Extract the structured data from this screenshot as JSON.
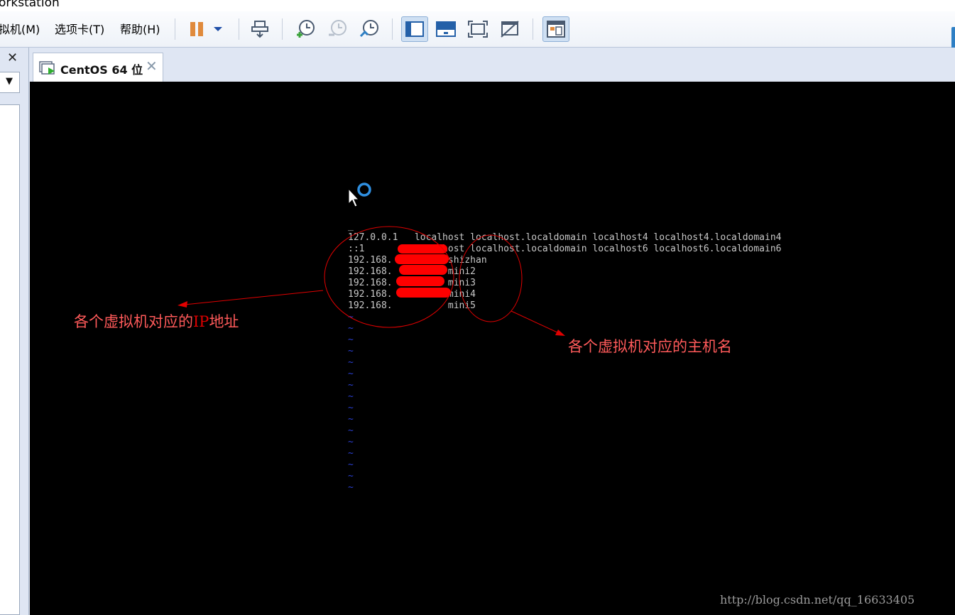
{
  "window": {
    "title_fragment": "orkstation"
  },
  "menu": [
    {
      "label": "拟机(M)"
    },
    {
      "label": "选项卡(T)"
    },
    {
      "label": "帮助(H)"
    }
  ],
  "toolbar_icons": [
    "pause-icon",
    "dropdown-arrow-icon",
    "send-ctrl-alt-del-icon",
    "snapshot-icon",
    "revert-snapshot-icon",
    "snapshot-manager-icon",
    "console-view-icon",
    "fullscreen-bar-icon",
    "fit-guest-icon",
    "unity-icon",
    "thumbnail-icon"
  ],
  "left_panel": {
    "close_label": "✕",
    "dropdown_arrow": "▼"
  },
  "tab": {
    "label": "CentOS 64 位",
    "close": "✕"
  },
  "terminal": {
    "lines": [
      "_",
      "127.0.0.1   localhost localhost.localdomain localhost4 localhost4.localdomain4",
      "::1         localhost localhost.localdomain localhost6 localhost6.localdomain6",
      "192.168.          shizhan",
      "192.168.          mini2",
      "192.168.          mini3",
      "192.168.          mini4",
      "192.168.          mini5"
    ],
    "tilde": "~"
  },
  "annotations": {
    "ip_prefix": "各个虚拟机对应的",
    "ip_highlight": "IP",
    "ip_suffix": "地址",
    "hostname": "各个虚拟机对应的主机名"
  },
  "watermark": "http://blog.csdn.net/qq_16633405",
  "colors": {
    "console_bg": "#000000",
    "annotation": "#ff5a5a",
    "redaction": "#ff0000",
    "tilde": "#2a3fd0",
    "accent": "#2e7fc4"
  }
}
